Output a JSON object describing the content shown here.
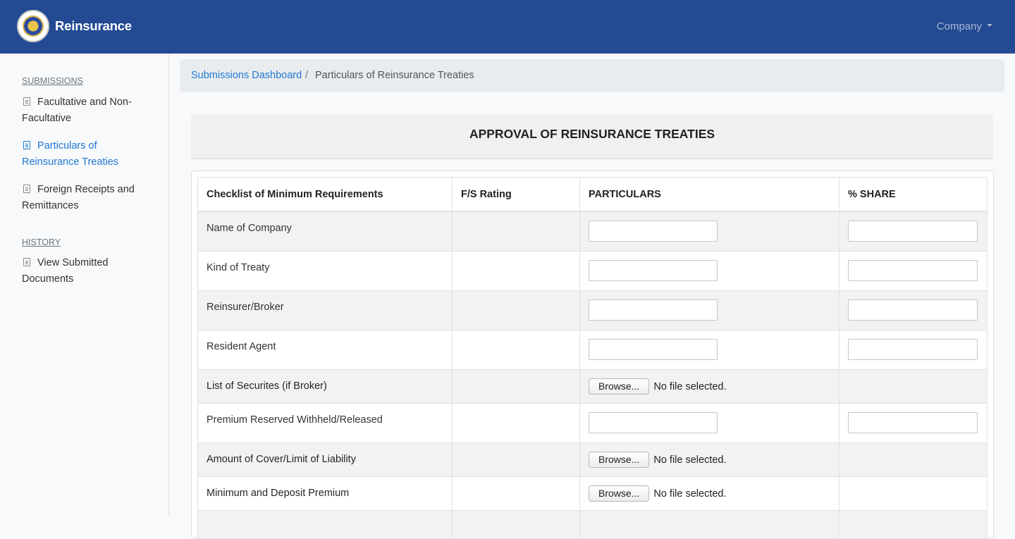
{
  "app": {
    "brand": "Reinsurance",
    "company_menu": "Company"
  },
  "sidebar": {
    "sections": [
      {
        "heading": "SUBMISSIONS",
        "items": [
          {
            "label": "Facultative and Non-Facultative",
            "active": false
          },
          {
            "label": "Particulars of Reinsurance Treaties",
            "active": true
          },
          {
            "label": "Foreign Receipts and Remittances",
            "active": false
          }
        ]
      },
      {
        "heading": "HISTORY",
        "items": [
          {
            "label": "View Submitted Documents",
            "active": false
          }
        ]
      }
    ]
  },
  "breadcrumb": {
    "link": "Submissions Dashboard",
    "separator": "/",
    "current": "Particulars of Reinsurance Treaties"
  },
  "page": {
    "title": "APPROVAL OF REINSURANCE TREATIES"
  },
  "table": {
    "headers": [
      "Checklist of Minimum Requirements",
      "F/S Rating",
      "PARTICULARS",
      "% SHARE"
    ],
    "rows": [
      {
        "label": "Name of Company",
        "type": "text",
        "particulars": "",
        "share": ""
      },
      {
        "label": "Kind of Treaty",
        "type": "text",
        "particulars": "",
        "share": ""
      },
      {
        "label": "Reinsurer/Broker",
        "type": "text",
        "particulars": "",
        "share": ""
      },
      {
        "label": "Resident Agent",
        "type": "text",
        "particulars": "",
        "share": ""
      },
      {
        "label": "List of Securites (if Broker)",
        "type": "file",
        "button": "Browse...",
        "status": "No file selected."
      },
      {
        "label": "Premium Reserved Withheld/Released",
        "type": "text",
        "particulars": "",
        "share": ""
      },
      {
        "label": "Amount of Cover/Limit of Liability",
        "type": "file",
        "button": "Browse...",
        "status": "No file selected."
      },
      {
        "label": "Minimum and Deposit Premium",
        "type": "file",
        "button": "Browse...",
        "status": "No file selected."
      }
    ]
  }
}
